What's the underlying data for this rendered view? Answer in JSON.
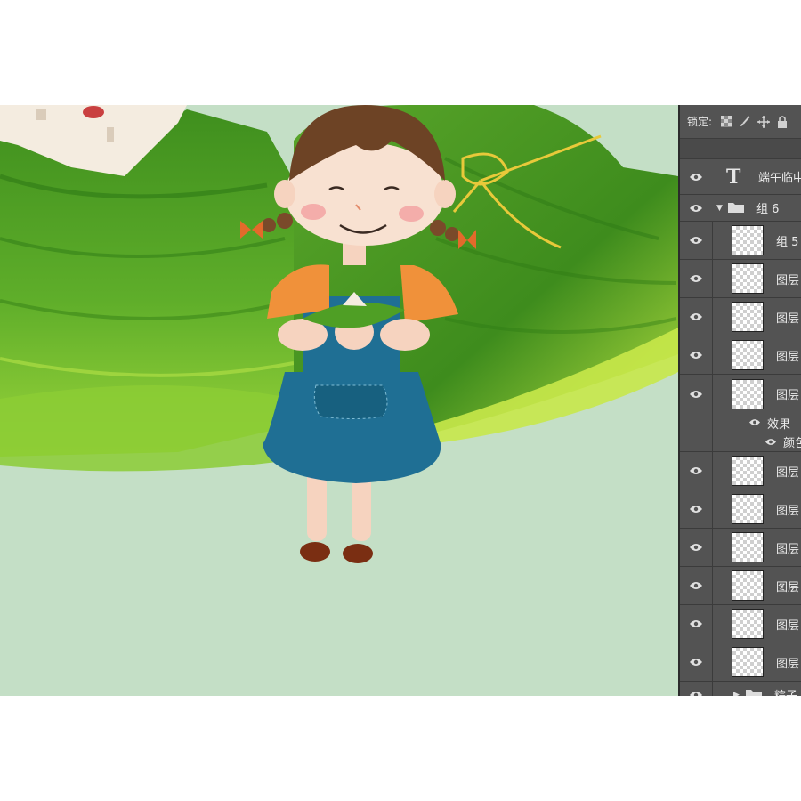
{
  "panel": {
    "lock_label": "锁定:",
    "lock_icons": [
      "lock-transparent-icon",
      "lock-brush-icon",
      "lock-move-icon",
      "lock-all-icon"
    ]
  },
  "layers": [
    {
      "kind": "text",
      "name": "端午临中"
    },
    {
      "kind": "group",
      "name": "组 6",
      "expanded": true
    },
    {
      "kind": "layer",
      "name": "组 5"
    },
    {
      "kind": "layer",
      "name": "图层"
    },
    {
      "kind": "layer",
      "name": "图层"
    },
    {
      "kind": "layer",
      "name": "图层"
    },
    {
      "kind": "layer",
      "name": "图层"
    },
    {
      "kind": "effect",
      "name": "效果"
    },
    {
      "kind": "effect-item",
      "name": "颜色"
    },
    {
      "kind": "layer",
      "name": "图层"
    },
    {
      "kind": "layer",
      "name": "图层"
    },
    {
      "kind": "layer",
      "name": "图层"
    },
    {
      "kind": "layer",
      "name": "图层"
    },
    {
      "kind": "layer",
      "name": "图层"
    },
    {
      "kind": "layer",
      "name": "图层"
    },
    {
      "kind": "group",
      "name": "粽子",
      "expanded": false
    }
  ],
  "colors": {
    "canvas_bg": "#c4dfc6",
    "panel_bg": "#535353",
    "leaf_green": "#5fae2a",
    "overall_blue": "#1f6f94",
    "shirt_orange": "#f0913a"
  }
}
